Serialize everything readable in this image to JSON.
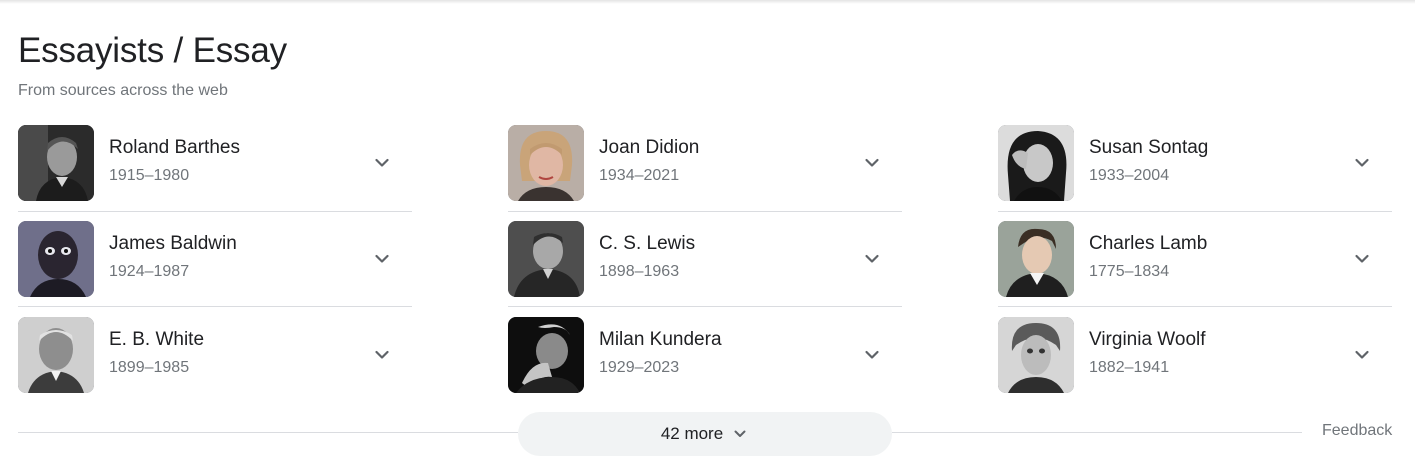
{
  "header": {
    "title": "Essayists / Essay",
    "subtitle": "From sources across the web"
  },
  "people": [
    [
      {
        "name": "Roland Barthes",
        "years": "1915–1980",
        "photo_icon": "portrait-roland-barthes"
      },
      {
        "name": "James Baldwin",
        "years": "1924–1987",
        "photo_icon": "portrait-james-baldwin"
      },
      {
        "name": "E. B. White",
        "years": "1899–1985",
        "photo_icon": "portrait-eb-white"
      }
    ],
    [
      {
        "name": "Joan Didion",
        "years": "1934–2021",
        "photo_icon": "portrait-joan-didion"
      },
      {
        "name": "C. S. Lewis",
        "years": "1898–1963",
        "photo_icon": "portrait-cs-lewis"
      },
      {
        "name": "Milan Kundera",
        "years": "1929–2023",
        "photo_icon": "portrait-milan-kundera"
      }
    ],
    [
      {
        "name": "Susan Sontag",
        "years": "1933–2004",
        "photo_icon": "portrait-susan-sontag"
      },
      {
        "name": "Charles Lamb",
        "years": "1775–1834",
        "photo_icon": "portrait-charles-lamb"
      },
      {
        "name": "Virginia Woolf",
        "years": "1882–1941",
        "photo_icon": "portrait-virginia-woolf"
      }
    ]
  ],
  "more": {
    "label": "42 more",
    "icon": "chevron-down-icon"
  },
  "feedback": {
    "label": "Feedback"
  },
  "colors": {
    "title": "#202124",
    "secondary_text": "#70757a",
    "divider": "#dadce0",
    "more_button_bg": "#f1f3f4",
    "chevron": "#5f6368"
  }
}
